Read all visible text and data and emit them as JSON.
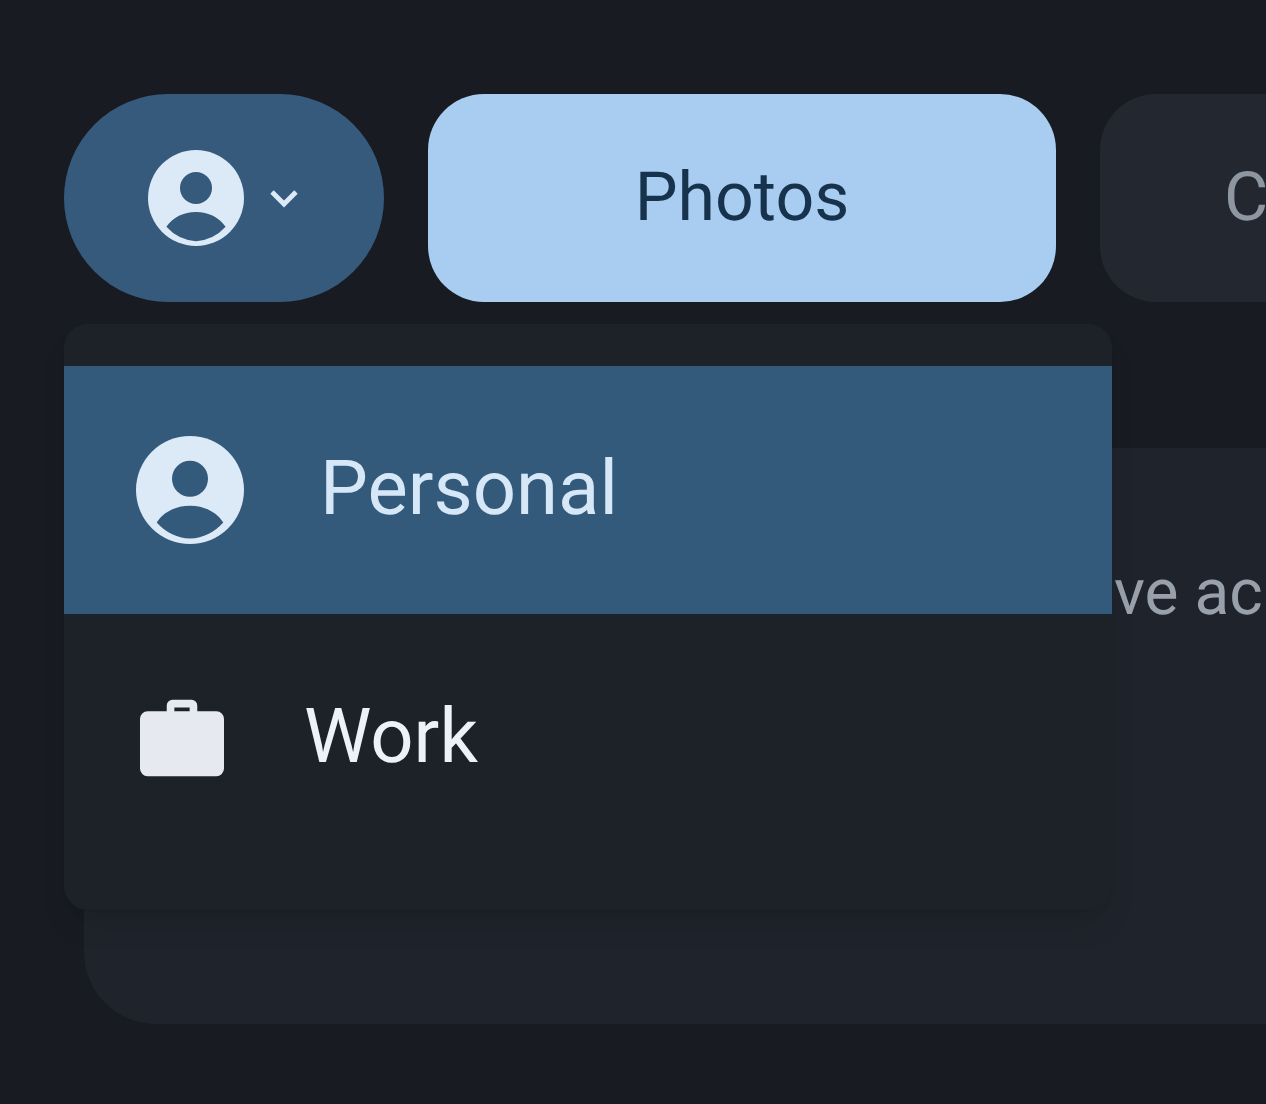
{
  "account_button": {
    "expanded": true
  },
  "tabs": [
    {
      "label": "Photos",
      "selected": true
    },
    {
      "label": "C",
      "selected": false
    }
  ],
  "background_card": {
    "text": "ve ac"
  },
  "account_menu": {
    "items": [
      {
        "label": "Personal",
        "kind": "person",
        "selected": true
      },
      {
        "label": "Work",
        "kind": "work",
        "selected": false
      }
    ]
  }
}
